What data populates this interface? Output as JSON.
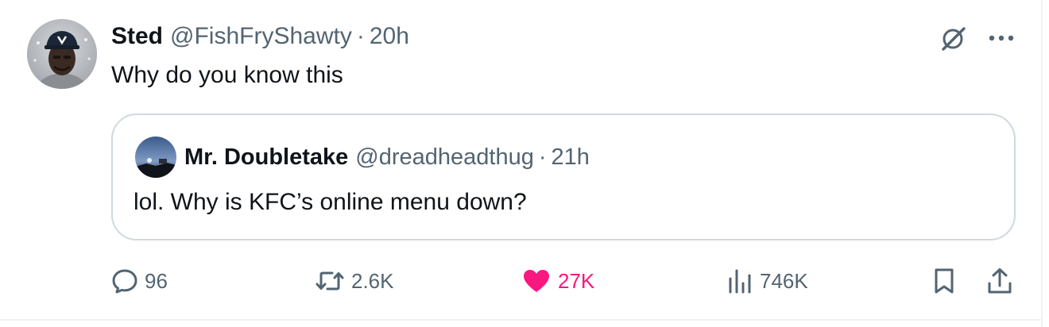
{
  "tweet": {
    "author_name": "Sted",
    "author_handle": "@FishFryShawty",
    "separator": "·",
    "time": "20h",
    "text": "Why do you know this",
    "avatar_icon": "user-avatar",
    "quoted": {
      "author_name": "Mr. Doubletake",
      "author_handle": "@dreadheadthug",
      "separator": "·",
      "time": "21h",
      "text": "lol. Why is KFC’s online menu down?",
      "avatar_icon": "night-sky-avatar"
    }
  },
  "actions": {
    "replies": "96",
    "reposts": "2.6K",
    "likes": "27K",
    "views": "746K",
    "liked": true,
    "like_color": "#f91880",
    "muted_color": "#536471"
  },
  "icons": {
    "grok": "grok-icon",
    "more": "more-icon",
    "reply": "reply-icon",
    "repost": "repost-icon",
    "like": "heart-icon",
    "views": "views-icon",
    "bookmark": "bookmark-icon",
    "share": "share-icon"
  }
}
